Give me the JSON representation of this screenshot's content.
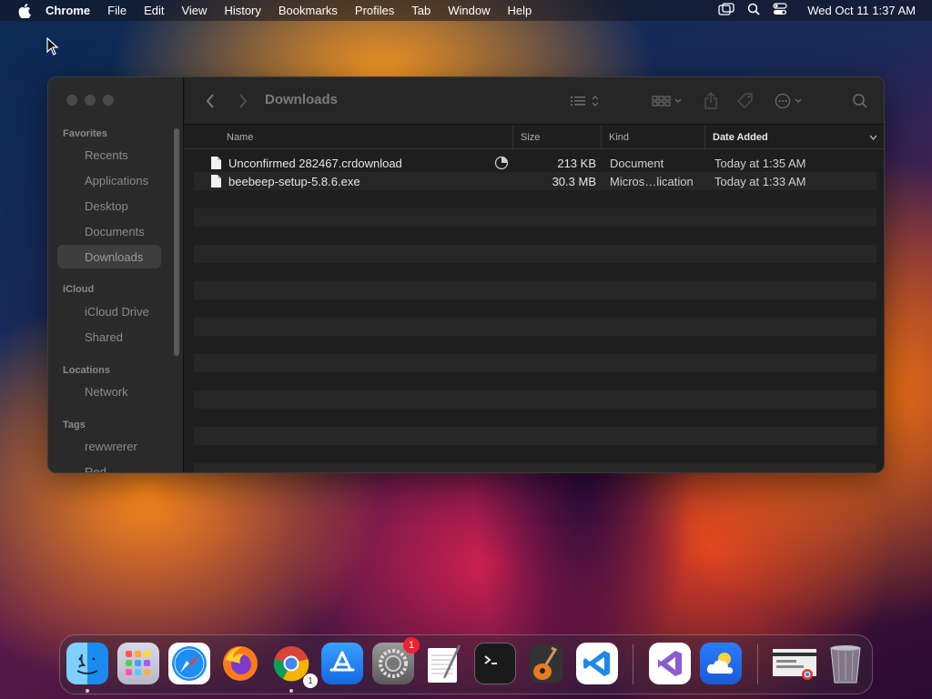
{
  "menubar": {
    "app": "Chrome",
    "items": [
      "File",
      "Edit",
      "View",
      "History",
      "Bookmarks",
      "Profiles",
      "Tab",
      "Window",
      "Help"
    ],
    "clock": "Wed Oct 11  1:37 AM"
  },
  "finder": {
    "title": "Downloads",
    "sidebar": {
      "favorites_label": "Favorites",
      "favorites": [
        "Recents",
        "Applications",
        "Desktop",
        "Documents",
        "Downloads"
      ],
      "icloud_label": "iCloud",
      "icloud": [
        "iCloud Drive",
        "Shared"
      ],
      "locations_label": "Locations",
      "locations": [
        "Network"
      ],
      "tags_label": "Tags",
      "tags": [
        "rewwrerer",
        "Red"
      ]
    },
    "columns": {
      "name": "Name",
      "size": "Size",
      "kind": "Kind",
      "date": "Date Added"
    },
    "files": [
      {
        "name": "Unconfirmed 282467.crdownload",
        "size": "213 KB",
        "kind": "Document",
        "date": "Today at 1:35 AM"
      },
      {
        "name": "beebeep-setup-5.8.6.exe",
        "size": "30.3 MB",
        "kind": "Micros…lication",
        "date": "Today at 1:33 AM"
      }
    ]
  },
  "dock": {
    "badges": {
      "system_settings": "1",
      "chrome_download": "1"
    }
  }
}
